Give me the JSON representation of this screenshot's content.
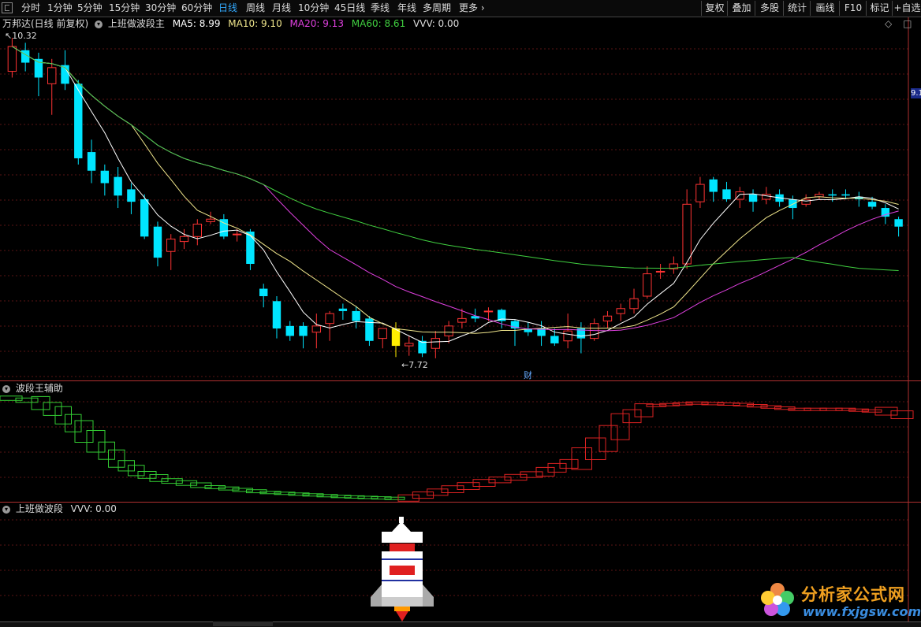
{
  "toolbar": {
    "periods": [
      "分时",
      "1分钟",
      "5分钟",
      "15分钟",
      "30分钟",
      "60分钟",
      "日线",
      "周线",
      "月线",
      "10分钟",
      "45日线",
      "季线",
      "年线",
      "多周期",
      "更多"
    ],
    "active_period": "日线",
    "right_buttons": [
      "复权",
      "叠加",
      "多股",
      "统计",
      "画线",
      "F10",
      "标记",
      "+自选"
    ]
  },
  "main_panel": {
    "stock_label": "万邦达(日线 前复权)",
    "indicator": "上班做波段主",
    "ma5": "MA5: 8.99",
    "ma10": "MA10: 9.10",
    "ma20": "MA20: 9.13",
    "ma60": "MA60: 8.61",
    "vvv": "VVV: 0.00",
    "high_label": "10.32",
    "low_label": "7.72",
    "right_edge_tag": "9.1",
    "cai_label": "财"
  },
  "sub_panel_1": {
    "title": "波段王辅助"
  },
  "sub_panel_2": {
    "title": "上班做波段",
    "vvv": "VVV: 0.00"
  },
  "watermark": {
    "title": "分析家公式网",
    "url": "www.fxjgsw.com"
  },
  "colors": {
    "up": "#ff3333",
    "down": "#00e5ff",
    "ma5": "#ffffff",
    "ma10": "#f0e68c",
    "ma20": "#e040e0",
    "ma60": "#40d040",
    "divider": "#b03030",
    "active_tab": "#33aaff"
  },
  "chart_data": {
    "type": "candlestick",
    "price_range": [
      7.72,
      10.32
    ],
    "candles": [
      [
        10.05,
        10.25,
        10.32,
        10.0
      ],
      [
        10.22,
        10.12,
        10.28,
        10.05
      ],
      [
        10.15,
        10.0,
        10.2,
        9.85
      ],
      [
        9.95,
        10.08,
        10.15,
        9.7
      ],
      [
        10.1,
        9.95,
        10.22,
        9.9
      ],
      [
        9.95,
        9.35,
        9.98,
        9.3
      ],
      [
        9.4,
        9.25,
        9.5,
        9.15
      ],
      [
        9.25,
        9.15,
        9.3,
        9.05
      ],
      [
        9.2,
        9.05,
        9.28,
        8.95
      ],
      [
        9.1,
        9.0,
        9.15,
        8.9
      ],
      [
        9.02,
        8.72,
        9.06,
        8.7
      ],
      [
        8.8,
        8.55,
        8.84,
        8.48
      ],
      [
        8.6,
        8.7,
        8.74,
        8.45
      ],
      [
        8.68,
        8.72,
        8.78,
        8.62
      ],
      [
        8.72,
        8.82,
        8.86,
        8.65
      ],
      [
        8.84,
        8.86,
        8.92,
        8.82
      ],
      [
        8.86,
        8.72,
        8.9,
        8.7
      ],
      [
        8.74,
        8.74,
        8.78,
        8.68
      ],
      [
        8.76,
        8.5,
        8.78,
        8.45
      ],
      [
        8.3,
        8.24,
        8.34,
        8.15
      ],
      [
        8.2,
        7.98,
        8.24,
        7.9
      ],
      [
        8.0,
        7.92,
        8.04,
        7.88
      ],
      [
        8.0,
        7.92,
        8.03,
        7.82
      ],
      [
        7.95,
        8.0,
        8.1,
        7.82
      ],
      [
        8.02,
        8.1,
        8.12,
        7.88
      ],
      [
        8.14,
        8.12,
        8.18,
        8.05
      ],
      [
        8.12,
        8.04,
        8.16,
        7.98
      ],
      [
        8.06,
        7.88,
        8.08,
        7.84
      ],
      [
        7.9,
        7.98,
        7.98,
        7.82
      ],
      [
        7.98,
        7.84,
        8.03,
        7.75
      ],
      [
        7.84,
        7.86,
        7.92,
        7.76
      ],
      [
        7.88,
        7.78,
        7.92,
        7.75
      ],
      [
        7.82,
        7.9,
        7.96,
        7.74
      ],
      [
        7.92,
        8.0,
        8.04,
        7.86
      ],
      [
        8.03,
        8.06,
        8.14,
        7.98
      ],
      [
        8.08,
        8.06,
        8.14,
        8.03
      ],
      [
        8.12,
        8.12,
        8.15,
        8.04
      ],
      [
        8.13,
        8.04,
        8.14,
        7.98
      ],
      [
        8.04,
        7.98,
        8.05,
        7.84
      ],
      [
        7.98,
        7.95,
        8.03,
        7.92
      ],
      [
        7.98,
        7.92,
        8.04,
        7.84
      ],
      [
        7.92,
        7.86,
        7.98,
        7.84
      ],
      [
        7.88,
        7.96,
        8.1,
        7.82
      ],
      [
        7.98,
        7.9,
        8.03,
        7.78
      ],
      [
        7.9,
        8.02,
        8.06,
        7.88
      ],
      [
        8.04,
        8.08,
        8.12,
        7.98
      ],
      [
        8.1,
        8.14,
        8.18,
        8.04
      ],
      [
        8.14,
        8.22,
        8.3,
        8.1
      ],
      [
        8.24,
        8.42,
        8.48,
        8.22
      ],
      [
        8.44,
        8.44,
        8.5,
        8.38
      ],
      [
        8.46,
        8.5,
        8.56,
        8.42
      ],
      [
        8.5,
        8.98,
        9.1,
        8.46
      ],
      [
        9.0,
        9.14,
        9.2,
        8.95
      ],
      [
        9.18,
        9.08,
        9.2,
        9.0
      ],
      [
        9.1,
        9.02,
        9.16,
        9.0
      ],
      [
        9.02,
        9.08,
        9.12,
        8.95
      ],
      [
        9.06,
        9.0,
        9.1,
        8.92
      ],
      [
        9.02,
        9.06,
        9.12,
        8.98
      ],
      [
        9.06,
        9.0,
        9.1,
        8.96
      ],
      [
        9.02,
        8.95,
        9.05,
        8.86
      ],
      [
        8.98,
        9.02,
        9.06,
        8.96
      ],
      [
        9.04,
        9.06,
        9.08,
        9.02
      ],
      [
        9.06,
        9.05,
        9.1,
        9.0
      ],
      [
        9.06,
        9.05,
        9.1,
        9.02
      ],
      [
        9.04,
        9.02,
        9.08,
        8.96
      ],
      [
        9.0,
        8.96,
        9.04,
        8.94
      ],
      [
        8.95,
        8.88,
        8.98,
        8.82
      ],
      [
        8.86,
        8.8,
        8.88,
        8.72
      ]
    ],
    "ma_series": [
      "MA5",
      "MA10",
      "MA20",
      "MA60"
    ]
  }
}
